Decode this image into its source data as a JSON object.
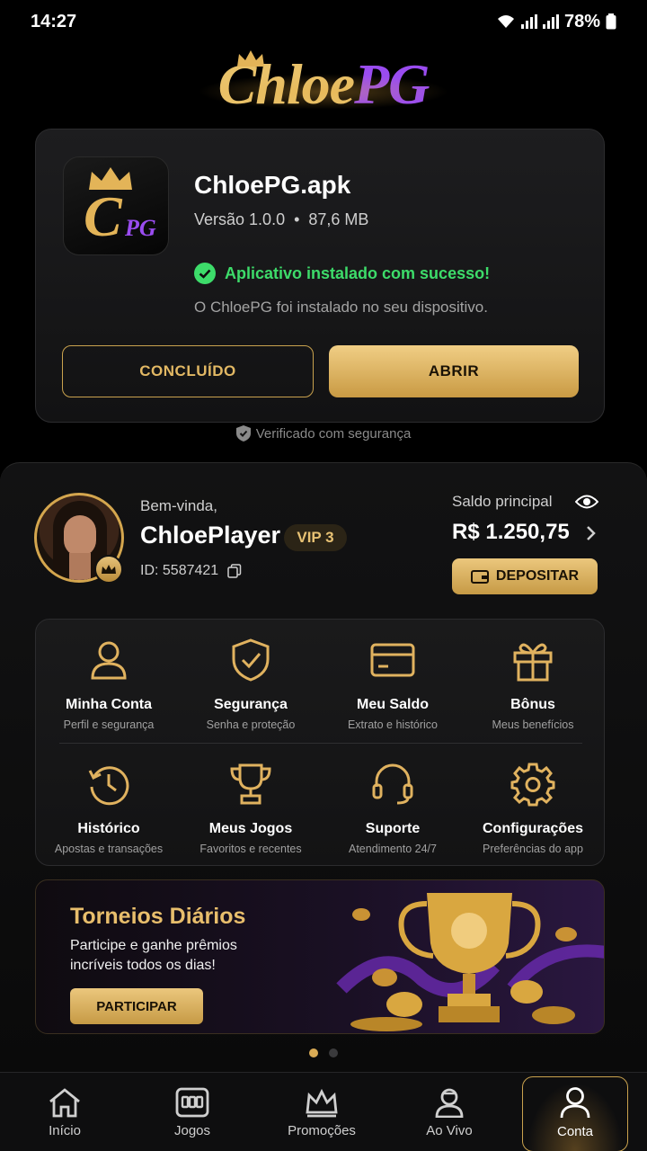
{
  "status_bar": {
    "time": "14:27",
    "battery": "78%"
  },
  "brand": {
    "logo_part1": "Chloe",
    "logo_part2": "PG"
  },
  "install": {
    "app_name": "ChloePG.apk",
    "version": "Versão 1.0.0",
    "size": "87,6 MB",
    "success_message": "Aplicativo instalado com sucesso!",
    "success_description": "O ChloePG foi instalado no seu dispositivo.",
    "done_label": "CONCLUÍDO",
    "open_label": "ABRIR",
    "icon_c": "C",
    "icon_pg": "PG"
  },
  "verified_text": "Verificado com segurança",
  "profile": {
    "greeting": "Bem-vinda,",
    "username": "ChloePlayer",
    "vip": "VIP 3",
    "user_id": "ID: 5587421",
    "balance_label": "Saldo principal",
    "balance_value": "R$ 1.250,75",
    "deposit_label": "DEPOSITAR"
  },
  "menu": [
    {
      "title": "Minha Conta",
      "subtitle": "Perfil e segurança",
      "icon": "user-icon"
    },
    {
      "title": "Segurança",
      "subtitle": "Senha e proteção",
      "icon": "shield-check-icon"
    },
    {
      "title": "Meu Saldo",
      "subtitle": "Extrato e histórico",
      "icon": "card-icon"
    },
    {
      "title": "Bônus",
      "subtitle": "Meus benefícios",
      "icon": "gift-icon"
    },
    {
      "title": "Histórico",
      "subtitle": "Apostas e transações",
      "icon": "history-icon"
    },
    {
      "title": "Meus Jogos",
      "subtitle": "Favoritos e recentes",
      "icon": "trophy-icon"
    },
    {
      "title": "Suporte",
      "subtitle": "Atendimento 24/7",
      "icon": "headset-icon"
    },
    {
      "title": "Configurações",
      "subtitle": "Preferências do app",
      "icon": "gear-icon"
    }
  ],
  "promo": {
    "title": "Torneios Diários",
    "description": "Participe e ganhe prêmios incríveis todos os dias!",
    "button_label": "PARTICIPAR"
  },
  "nav": [
    {
      "label": "Início",
      "icon": "home-icon"
    },
    {
      "label": "Jogos",
      "icon": "slots-icon"
    },
    {
      "label": "Promoções",
      "icon": "crown-icon"
    },
    {
      "label": "Ao Vivo",
      "icon": "live-dealer-icon"
    },
    {
      "label": "Conta",
      "icon": "account-icon",
      "active": true
    }
  ],
  "colors": {
    "gold": "#d9ab55",
    "purple": "#9a4cf0",
    "success": "#3ddc6a",
    "background": "#000000"
  }
}
